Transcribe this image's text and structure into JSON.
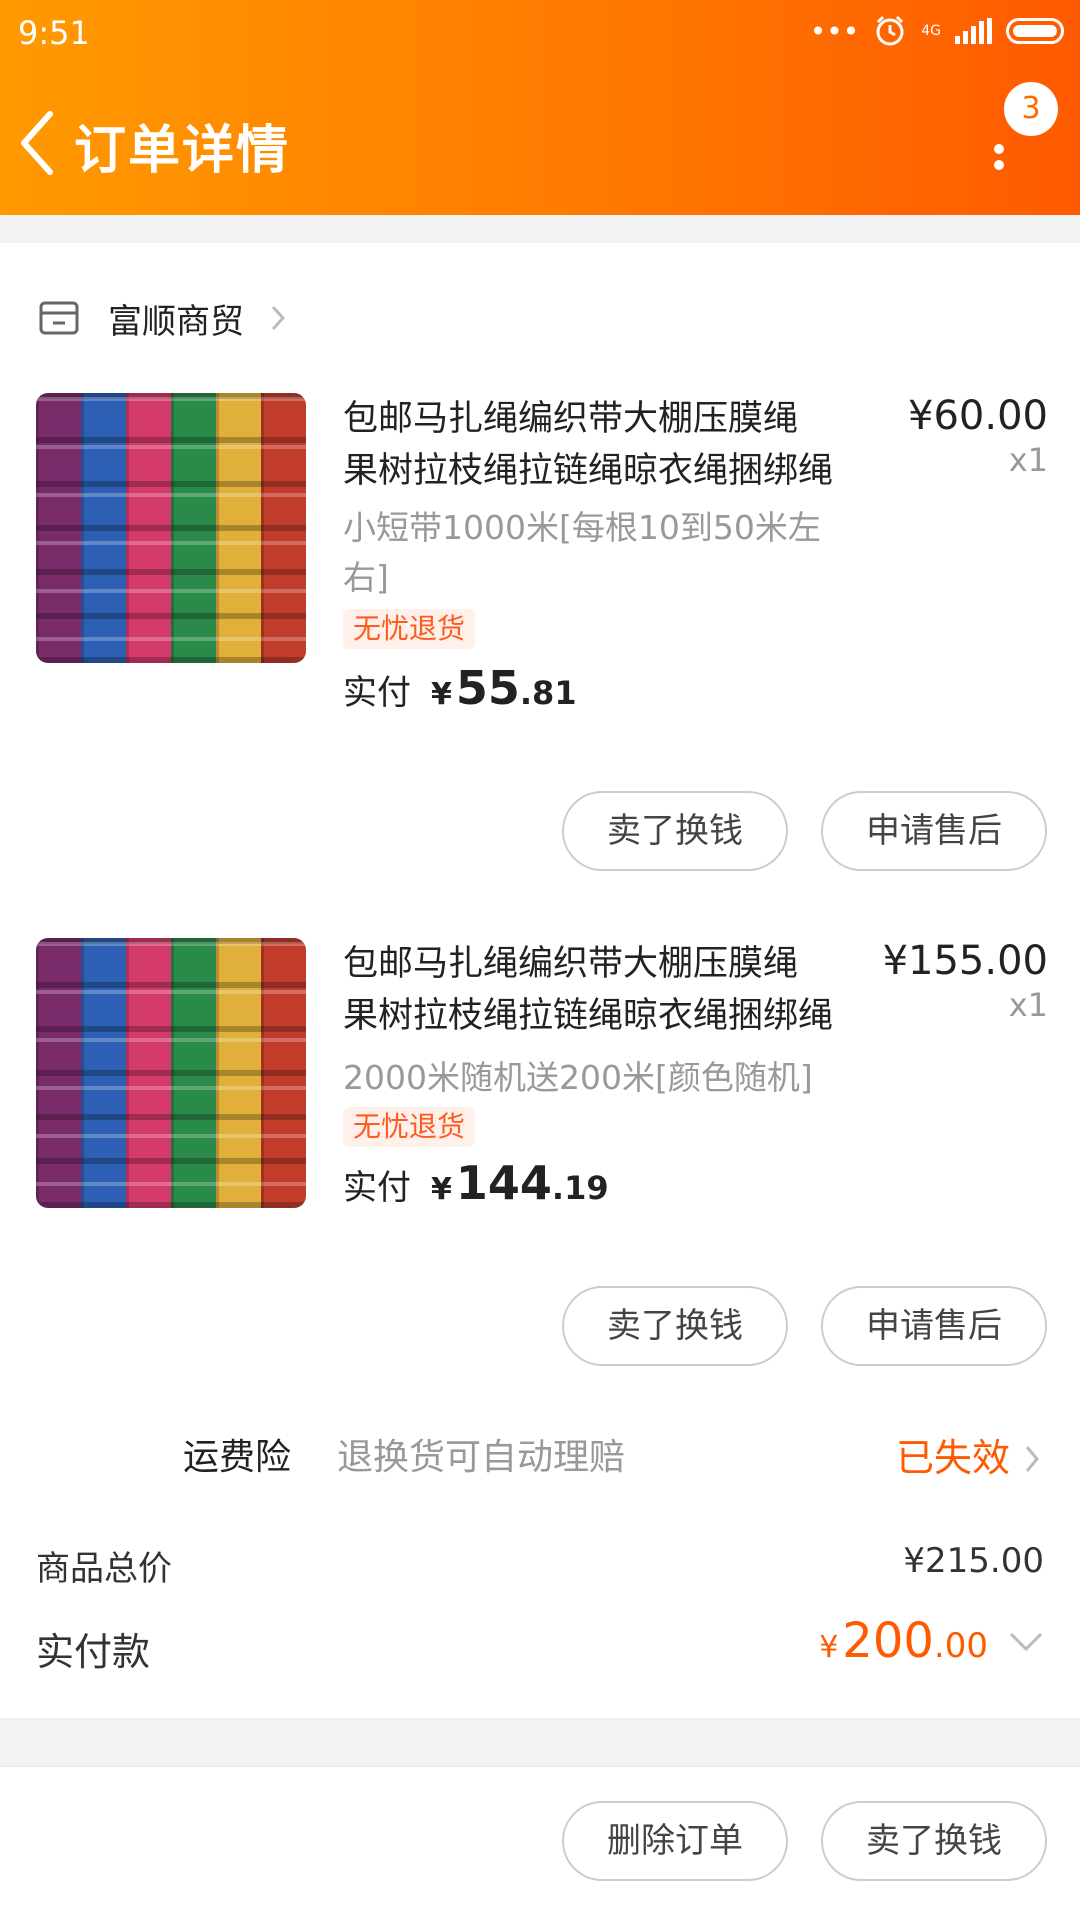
{
  "status_bar": {
    "time": "9:51",
    "network": "4G"
  },
  "header": {
    "title": "订单详情",
    "badge_count": "3"
  },
  "shop": {
    "name": "富顺商贸"
  },
  "items": [
    {
      "title_line1": "包邮马扎绳编织带大棚压膜绳",
      "title_line2": "果树拉枝绳拉链绳晾衣绳捆绑绳",
      "price": "¥60.00",
      "qty": "x1",
      "sku": "小短带1000米[每根10到50米左右]",
      "tag": "无忧退货",
      "paid_label": "实付",
      "paid_yen": "¥",
      "paid_int": "55",
      "paid_dec": ".81",
      "btn_sell": "卖了换钱",
      "btn_after": "申请售后"
    },
    {
      "title_line1": "包邮马扎绳编织带大棚压膜绳",
      "title_line2": "果树拉枝绳拉链绳晾衣绳捆绑绳",
      "price": "¥155.00",
      "qty": "x1",
      "sku": "2000米随机送200米[颜色随机]",
      "tag": "无忧退货",
      "paid_label": "实付",
      "paid_yen": "¥",
      "paid_int": "144",
      "paid_dec": ".19",
      "btn_sell": "卖了换钱",
      "btn_after": "申请售后"
    }
  ],
  "insurance": {
    "label": "运费险",
    "desc": "退换货可自动理赔",
    "status": "已失效"
  },
  "summary": {
    "goods_total_label": "商品总价",
    "goods_total_value": "¥215.00",
    "paid_label": "实付款",
    "paid_yen": "¥",
    "paid_int": "200",
    "paid_dec": ".00"
  },
  "bottom": {
    "delete_label": "删除订单",
    "sell_label": "卖了换钱"
  },
  "colors": {
    "header_start": "#ff9a00",
    "header_end": "#ff5a00",
    "accent": "#ff5a00"
  }
}
